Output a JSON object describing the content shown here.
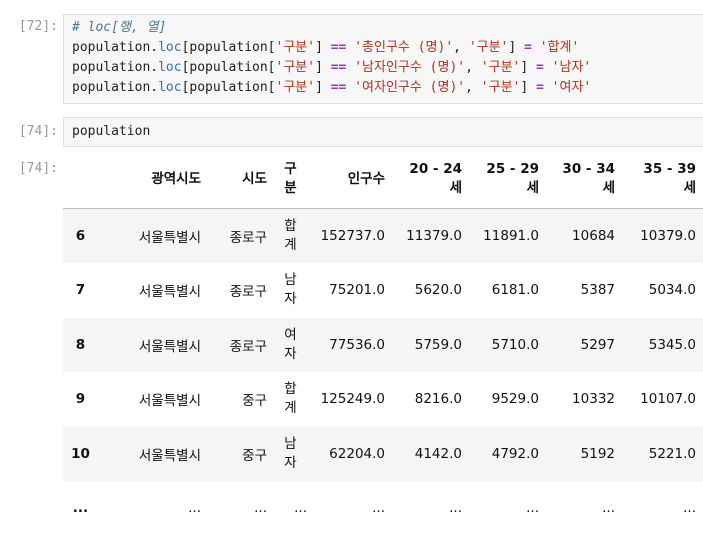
{
  "cells": [
    {
      "prompt": "[72]:",
      "code_lines": [
        [
          {
            "t": "# loc[행, 열]",
            "c": "cm"
          }
        ],
        [
          {
            "t": "population.",
            "c": ""
          },
          {
            "t": "loc",
            "c": "fn"
          },
          {
            "t": "[population[",
            "c": ""
          },
          {
            "t": "'구분'",
            "c": "st"
          },
          {
            "t": "] ",
            "c": ""
          },
          {
            "t": "==",
            "c": "op"
          },
          {
            "t": " ",
            "c": ""
          },
          {
            "t": "'총인구수 (명)'",
            "c": "st"
          },
          {
            "t": ", ",
            "c": ""
          },
          {
            "t": "'구분'",
            "c": "st"
          },
          {
            "t": "] ",
            "c": ""
          },
          {
            "t": "=",
            "c": "op"
          },
          {
            "t": " ",
            "c": ""
          },
          {
            "t": "'합계'",
            "c": "st"
          }
        ],
        [
          {
            "t": "population.",
            "c": ""
          },
          {
            "t": "loc",
            "c": "fn"
          },
          {
            "t": "[population[",
            "c": ""
          },
          {
            "t": "'구분'",
            "c": "st"
          },
          {
            "t": "] ",
            "c": ""
          },
          {
            "t": "==",
            "c": "op"
          },
          {
            "t": " ",
            "c": ""
          },
          {
            "t": "'남자인구수 (명)'",
            "c": "st"
          },
          {
            "t": ", ",
            "c": ""
          },
          {
            "t": "'구분'",
            "c": "st"
          },
          {
            "t": "] ",
            "c": ""
          },
          {
            "t": "=",
            "c": "op"
          },
          {
            "t": " ",
            "c": ""
          },
          {
            "t": "'남자'",
            "c": "st"
          }
        ],
        [
          {
            "t": "population.",
            "c": ""
          },
          {
            "t": "loc",
            "c": "fn"
          },
          {
            "t": "[population[",
            "c": ""
          },
          {
            "t": "'구분'",
            "c": "st"
          },
          {
            "t": "] ",
            "c": ""
          },
          {
            "t": "==",
            "c": "op"
          },
          {
            "t": " ",
            "c": ""
          },
          {
            "t": "'여자인구수 (명)'",
            "c": "st"
          },
          {
            "t": ", ",
            "c": ""
          },
          {
            "t": "'구분'",
            "c": "st"
          },
          {
            "t": "] ",
            "c": ""
          },
          {
            "t": "=",
            "c": "op"
          },
          {
            "t": " ",
            "c": ""
          },
          {
            "t": "'여자'",
            "c": "st"
          }
        ]
      ]
    },
    {
      "prompt": "[74]:",
      "code": "population"
    }
  ],
  "output": {
    "prompt": "[74]:",
    "columns": [
      "",
      "광역시도",
      "시도",
      "구분",
      "인구수",
      "20 - 24 세",
      "25 - 29 세",
      "30 - 34 세",
      "35 - 39 세"
    ],
    "rows": [
      [
        "6",
        "서울특별시",
        "종로구",
        "합계",
        "152737.0",
        "11379.0",
        "11891.0",
        "10684",
        "10379.0"
      ],
      [
        "7",
        "서울특별시",
        "종로구",
        "남자",
        "75201.0",
        "5620.0",
        "6181.0",
        "5387",
        "5034.0"
      ],
      [
        "8",
        "서울특별시",
        "종로구",
        "여자",
        "77536.0",
        "5759.0",
        "5710.0",
        "5297",
        "5345.0"
      ],
      [
        "9",
        "서울특별시",
        "중구",
        "합계",
        "125249.0",
        "8216.0",
        "9529.0",
        "10332",
        "10107.0"
      ],
      [
        "10",
        "서울특별시",
        "중구",
        "남자",
        "62204.0",
        "4142.0",
        "4792.0",
        "5192",
        "5221.0"
      ],
      [
        "...",
        "...",
        "...",
        "...",
        "...",
        "...",
        "...",
        "...",
        "..."
      ]
    ]
  }
}
